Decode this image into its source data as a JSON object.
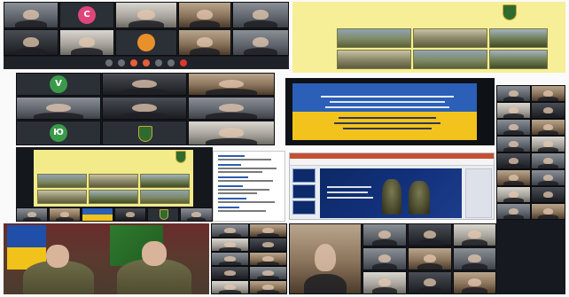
{
  "colors": {
    "slide_title_blue": "#1a1a6e",
    "slide_title_red": "#b5261e",
    "ua_blue": "#2b5fb8",
    "ua_yellow": "#f2c31c",
    "toolbar_orange": "#e85d3a",
    "avatar_pink": "#e0457a",
    "avatar_green": "#3a9a4a",
    "avatar_orange": "#e8902a"
  },
  "avatars": {
    "top_left_c": "C",
    "mid_v": "V",
    "mid_yu": "Ю"
  },
  "icons": {
    "mic": "mic-icon",
    "camera": "camera-icon",
    "share": "share-screen-icon",
    "end_call": "end-call-icon",
    "emblem": "military-emblem-icon"
  }
}
